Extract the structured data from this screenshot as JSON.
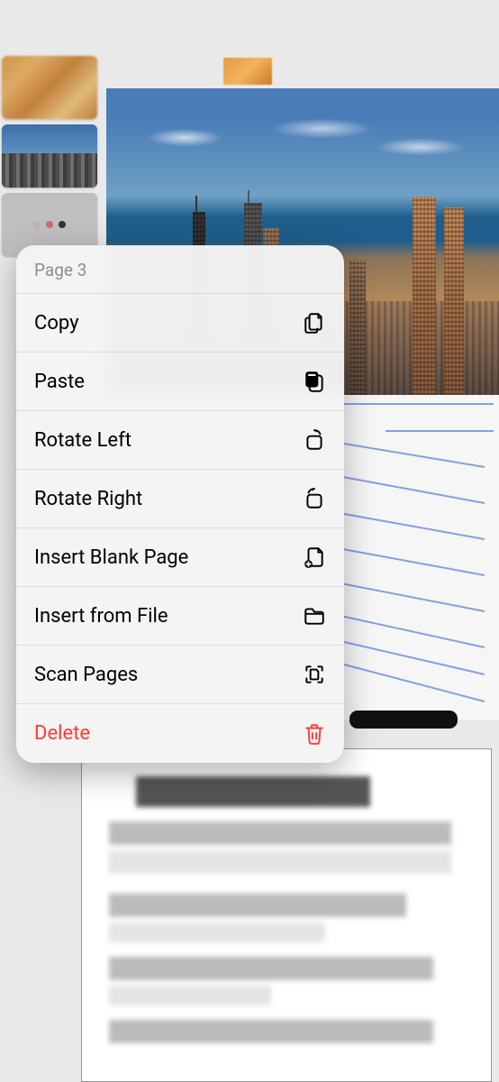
{
  "menu": {
    "header": "Page 3",
    "items": [
      {
        "label": "Copy",
        "icon": "copy-icon",
        "destructive": false
      },
      {
        "label": "Paste",
        "icon": "paste-icon",
        "destructive": false
      },
      {
        "label": "Rotate Left",
        "icon": "rotate-left-icon",
        "destructive": false
      },
      {
        "label": "Rotate Right",
        "icon": "rotate-right-icon",
        "destructive": false
      },
      {
        "label": "Insert Blank Page",
        "icon": "insert-blank-icon",
        "destructive": false
      },
      {
        "label": "Insert from File",
        "icon": "folder-icon",
        "destructive": false
      },
      {
        "label": "Scan Pages",
        "icon": "scan-icon",
        "destructive": false
      },
      {
        "label": "Delete",
        "icon": "trash-icon",
        "destructive": true
      }
    ]
  },
  "colors": {
    "destructive": "#ff3b30",
    "secondary_text": "#8e8e93"
  }
}
